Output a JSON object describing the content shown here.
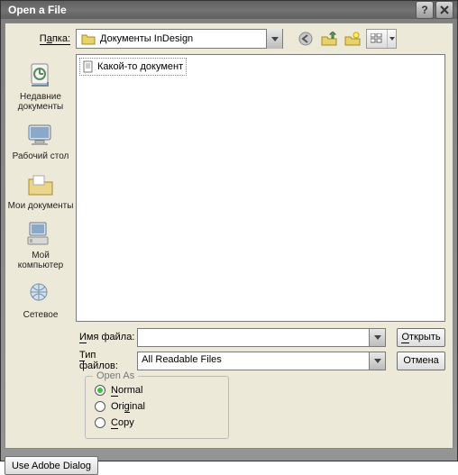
{
  "window": {
    "title": "Open a File"
  },
  "toprow": {
    "label_plain": "П",
    "label_u": "а",
    "label_rest": "пка:",
    "folder": "Документы InDesign"
  },
  "places": {
    "recent": "Недавние\nдокументы",
    "desktop": "Рабочий стол",
    "mydocs": "Мои документы",
    "mycomp": "Мой\nкомпьютер",
    "network": "Сетевое"
  },
  "file": {
    "name": "Какой-то документ"
  },
  "form": {
    "name_u": "И",
    "name_rest": "мя файла:",
    "type_u": "Т",
    "type_rest": "ип файлов:",
    "type_value": "All Readable Files",
    "open_u": "О",
    "open_rest": "ткрыть",
    "cancel": "Отмена"
  },
  "openas": {
    "title": "Open As",
    "normal_u": "N",
    "normal_rest": "ormal",
    "original_pre": "Ori",
    "original_u": "g",
    "original_rest": "inal",
    "copy_u": "C",
    "copy_rest": "opy"
  },
  "footer": {
    "adobe": "Use Adobe Dialog"
  }
}
